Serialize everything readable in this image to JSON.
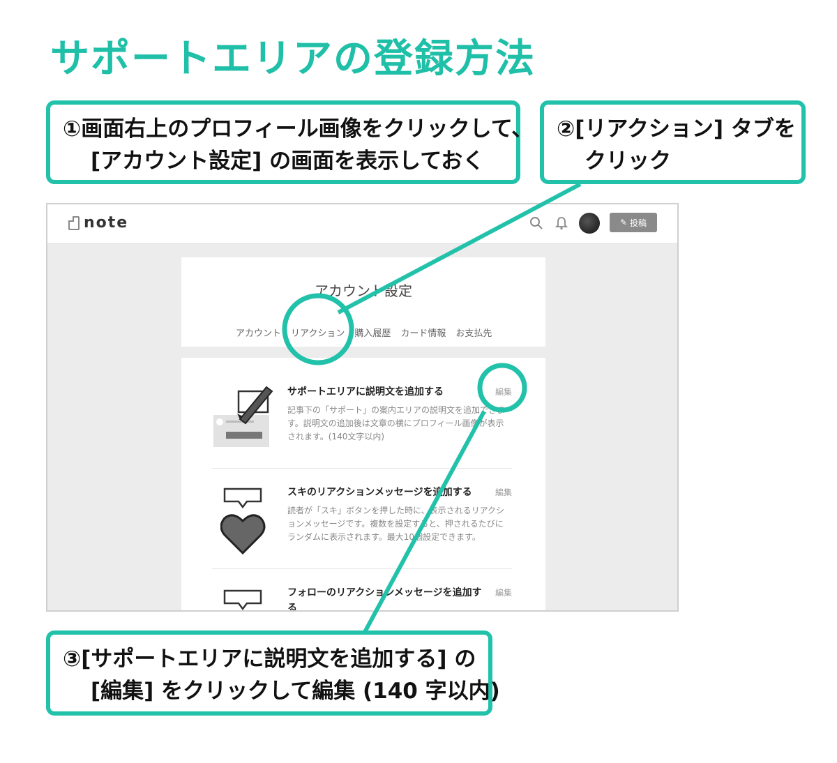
{
  "page_title": "サポートエリアの登録方法",
  "callouts": {
    "step1": {
      "line1": "①画面右上のプロフィール画像をクリックして、",
      "line2": "[アカウント設定] の画面を表示しておく"
    },
    "step2": {
      "line1": "②[リアクション] タブを",
      "line2": "クリック"
    },
    "step3": {
      "line1": "③[サポートエリアに説明文を追加する] の",
      "line2": "[編集] をクリックして編集 (140 字以内)"
    }
  },
  "app": {
    "logo": "note",
    "post_button": "投稿",
    "header_icons": [
      "search-icon",
      "bell-icon"
    ],
    "settings_title": "アカウント設定",
    "tabs": [
      "アカウント",
      "リアクション",
      "購入履歴",
      "カード情報",
      "お支払先"
    ],
    "items": [
      {
        "title": "サポートエリアに説明文を追加する",
        "edit": "編集",
        "desc": "記事下の「サポート」の案内エリアの説明文を追加できます。説明文の追加後は文章の横にプロフィール画像が表示されます。(140文字以内)"
      },
      {
        "title": "スキのリアクションメッセージを追加する",
        "edit": "編集",
        "desc": "読者が「スキ」ボタンを押した時に、表示されるリアクションメッセージです。複数を設定すると、押されるたびにランダムに表示されます。最大10個設定できます。"
      },
      {
        "title": "フォローのリアクションメッセージを追加する",
        "edit": "編集"
      }
    ]
  },
  "colors": {
    "accent": "#22c1aa",
    "title": "#1fbfa8"
  }
}
